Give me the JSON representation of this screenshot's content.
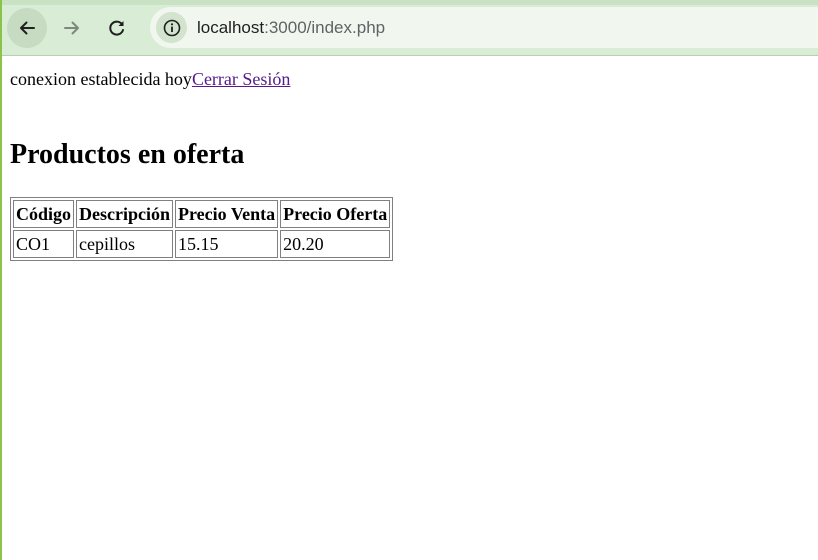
{
  "browser": {
    "url_host": "localhost",
    "url_path": ":3000/index.php"
  },
  "page": {
    "status_text": "conexion establecida hoy",
    "logout_link": "Cerrar Sesión",
    "title": "Productos en oferta"
  },
  "table": {
    "headers": [
      "Código",
      "Descripción",
      "Precio Venta",
      "Precio Oferta"
    ],
    "rows": [
      [
        "CO1",
        "cepillos",
        "15.15",
        "20.20"
      ]
    ]
  },
  "colors": {
    "toolbar_bg": "#d9ecd6",
    "omnibox_bg": "#f1f7ef",
    "visited_link": "#551a8b",
    "accent": "#8bc34a"
  }
}
